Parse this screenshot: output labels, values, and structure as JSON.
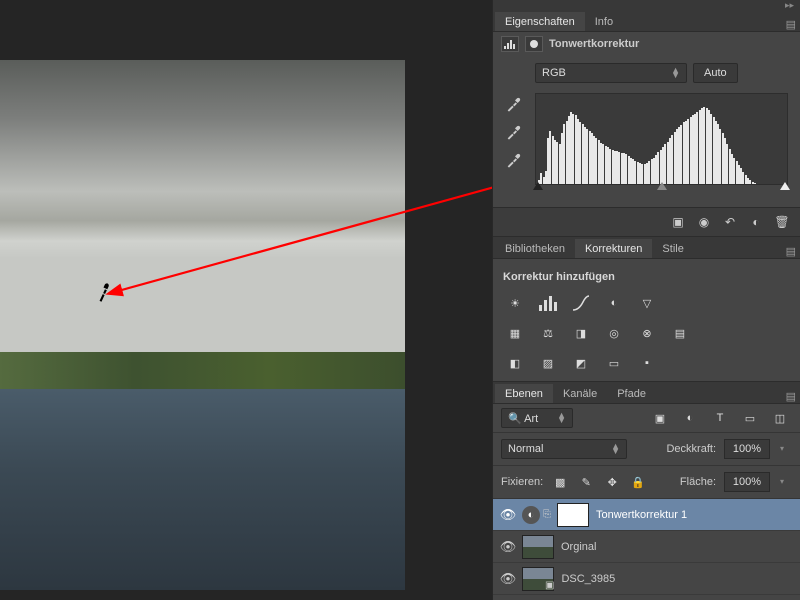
{
  "properties": {
    "tabs": [
      "Eigenschaften",
      "Info"
    ],
    "title": "Tonwertkorrektur",
    "channel": "RGB",
    "auto": "Auto"
  },
  "libraries": {
    "tabs": [
      "Bibliotheken",
      "Korrekturen",
      "Stile"
    ],
    "heading": "Korrektur hinzufügen"
  },
  "layers": {
    "tabs": [
      "Ebenen",
      "Kanäle",
      "Pfade"
    ],
    "filterLabel": "Art",
    "blendMode": "Normal",
    "opacityLabel": "Deckkraft:",
    "opacityValue": "100%",
    "lockLabel": "Fixieren:",
    "fillLabel": "Fläche:",
    "fillValue": "100%",
    "items": [
      {
        "name": "Tonwertkorrektur 1"
      },
      {
        "name": "Orginal"
      },
      {
        "name": "DSC_3985"
      }
    ]
  },
  "histogram": {
    "values": [
      5,
      12,
      8,
      15,
      52,
      60,
      55,
      50,
      48,
      45,
      58,
      68,
      72,
      77,
      82,
      80,
      78,
      74,
      70,
      68,
      65,
      63,
      60,
      58,
      55,
      52,
      50,
      47,
      45,
      43,
      42,
      40,
      39,
      38,
      37,
      36,
      35,
      35,
      34,
      32,
      30,
      28,
      26,
      25,
      24,
      23,
      23,
      24,
      26,
      28,
      30,
      33,
      36,
      39,
      42,
      45,
      48,
      52,
      56,
      59,
      62,
      65,
      67,
      70,
      72,
      74,
      76,
      78,
      80,
      82,
      84,
      86,
      87,
      86,
      84,
      80,
      76,
      72,
      68,
      63,
      58,
      52,
      46,
      40,
      34,
      30,
      26,
      22,
      18,
      14,
      10,
      7,
      4,
      2,
      1,
      0,
      0,
      0,
      0,
      0
    ]
  },
  "chart_data": {
    "type": "area",
    "title": "Histogram",
    "xlabel": "",
    "ylabel": "",
    "ylim": [
      0,
      100
    ],
    "x": [
      0,
      1,
      2,
      3,
      4,
      5,
      6,
      7,
      8,
      9,
      10,
      11,
      12,
      13,
      14,
      15,
      16,
      17,
      18,
      19,
      20,
      21,
      22,
      23,
      24,
      25,
      26,
      27,
      28,
      29,
      30,
      31,
      32,
      33,
      34,
      35,
      36,
      37,
      38,
      39,
      40,
      41,
      42,
      43,
      44,
      45,
      46,
      47,
      48,
      49,
      50,
      51,
      52,
      53,
      54,
      55,
      56,
      57,
      58,
      59,
      60,
      61,
      62,
      63,
      64,
      65,
      66,
      67,
      68,
      69,
      70,
      71,
      72,
      73,
      74,
      75,
      76,
      77,
      78,
      79,
      80,
      81,
      82,
      83,
      84,
      85,
      86,
      87,
      88,
      89,
      90,
      91,
      92,
      93,
      94,
      95,
      96,
      97,
      98,
      99
    ],
    "values": [
      5,
      12,
      8,
      15,
      52,
      60,
      55,
      50,
      48,
      45,
      58,
      68,
      72,
      77,
      82,
      80,
      78,
      74,
      70,
      68,
      65,
      63,
      60,
      58,
      55,
      52,
      50,
      47,
      45,
      43,
      42,
      40,
      39,
      38,
      37,
      36,
      35,
      35,
      34,
      32,
      30,
      28,
      26,
      25,
      24,
      23,
      23,
      24,
      26,
      28,
      30,
      33,
      36,
      39,
      42,
      45,
      48,
      52,
      56,
      59,
      62,
      65,
      67,
      70,
      72,
      74,
      76,
      78,
      80,
      82,
      84,
      86,
      87,
      86,
      84,
      80,
      76,
      72,
      68,
      63,
      58,
      52,
      46,
      40,
      34,
      30,
      26,
      22,
      18,
      14,
      10,
      7,
      4,
      2,
      1,
      0,
      0,
      0,
      0,
      0
    ]
  }
}
